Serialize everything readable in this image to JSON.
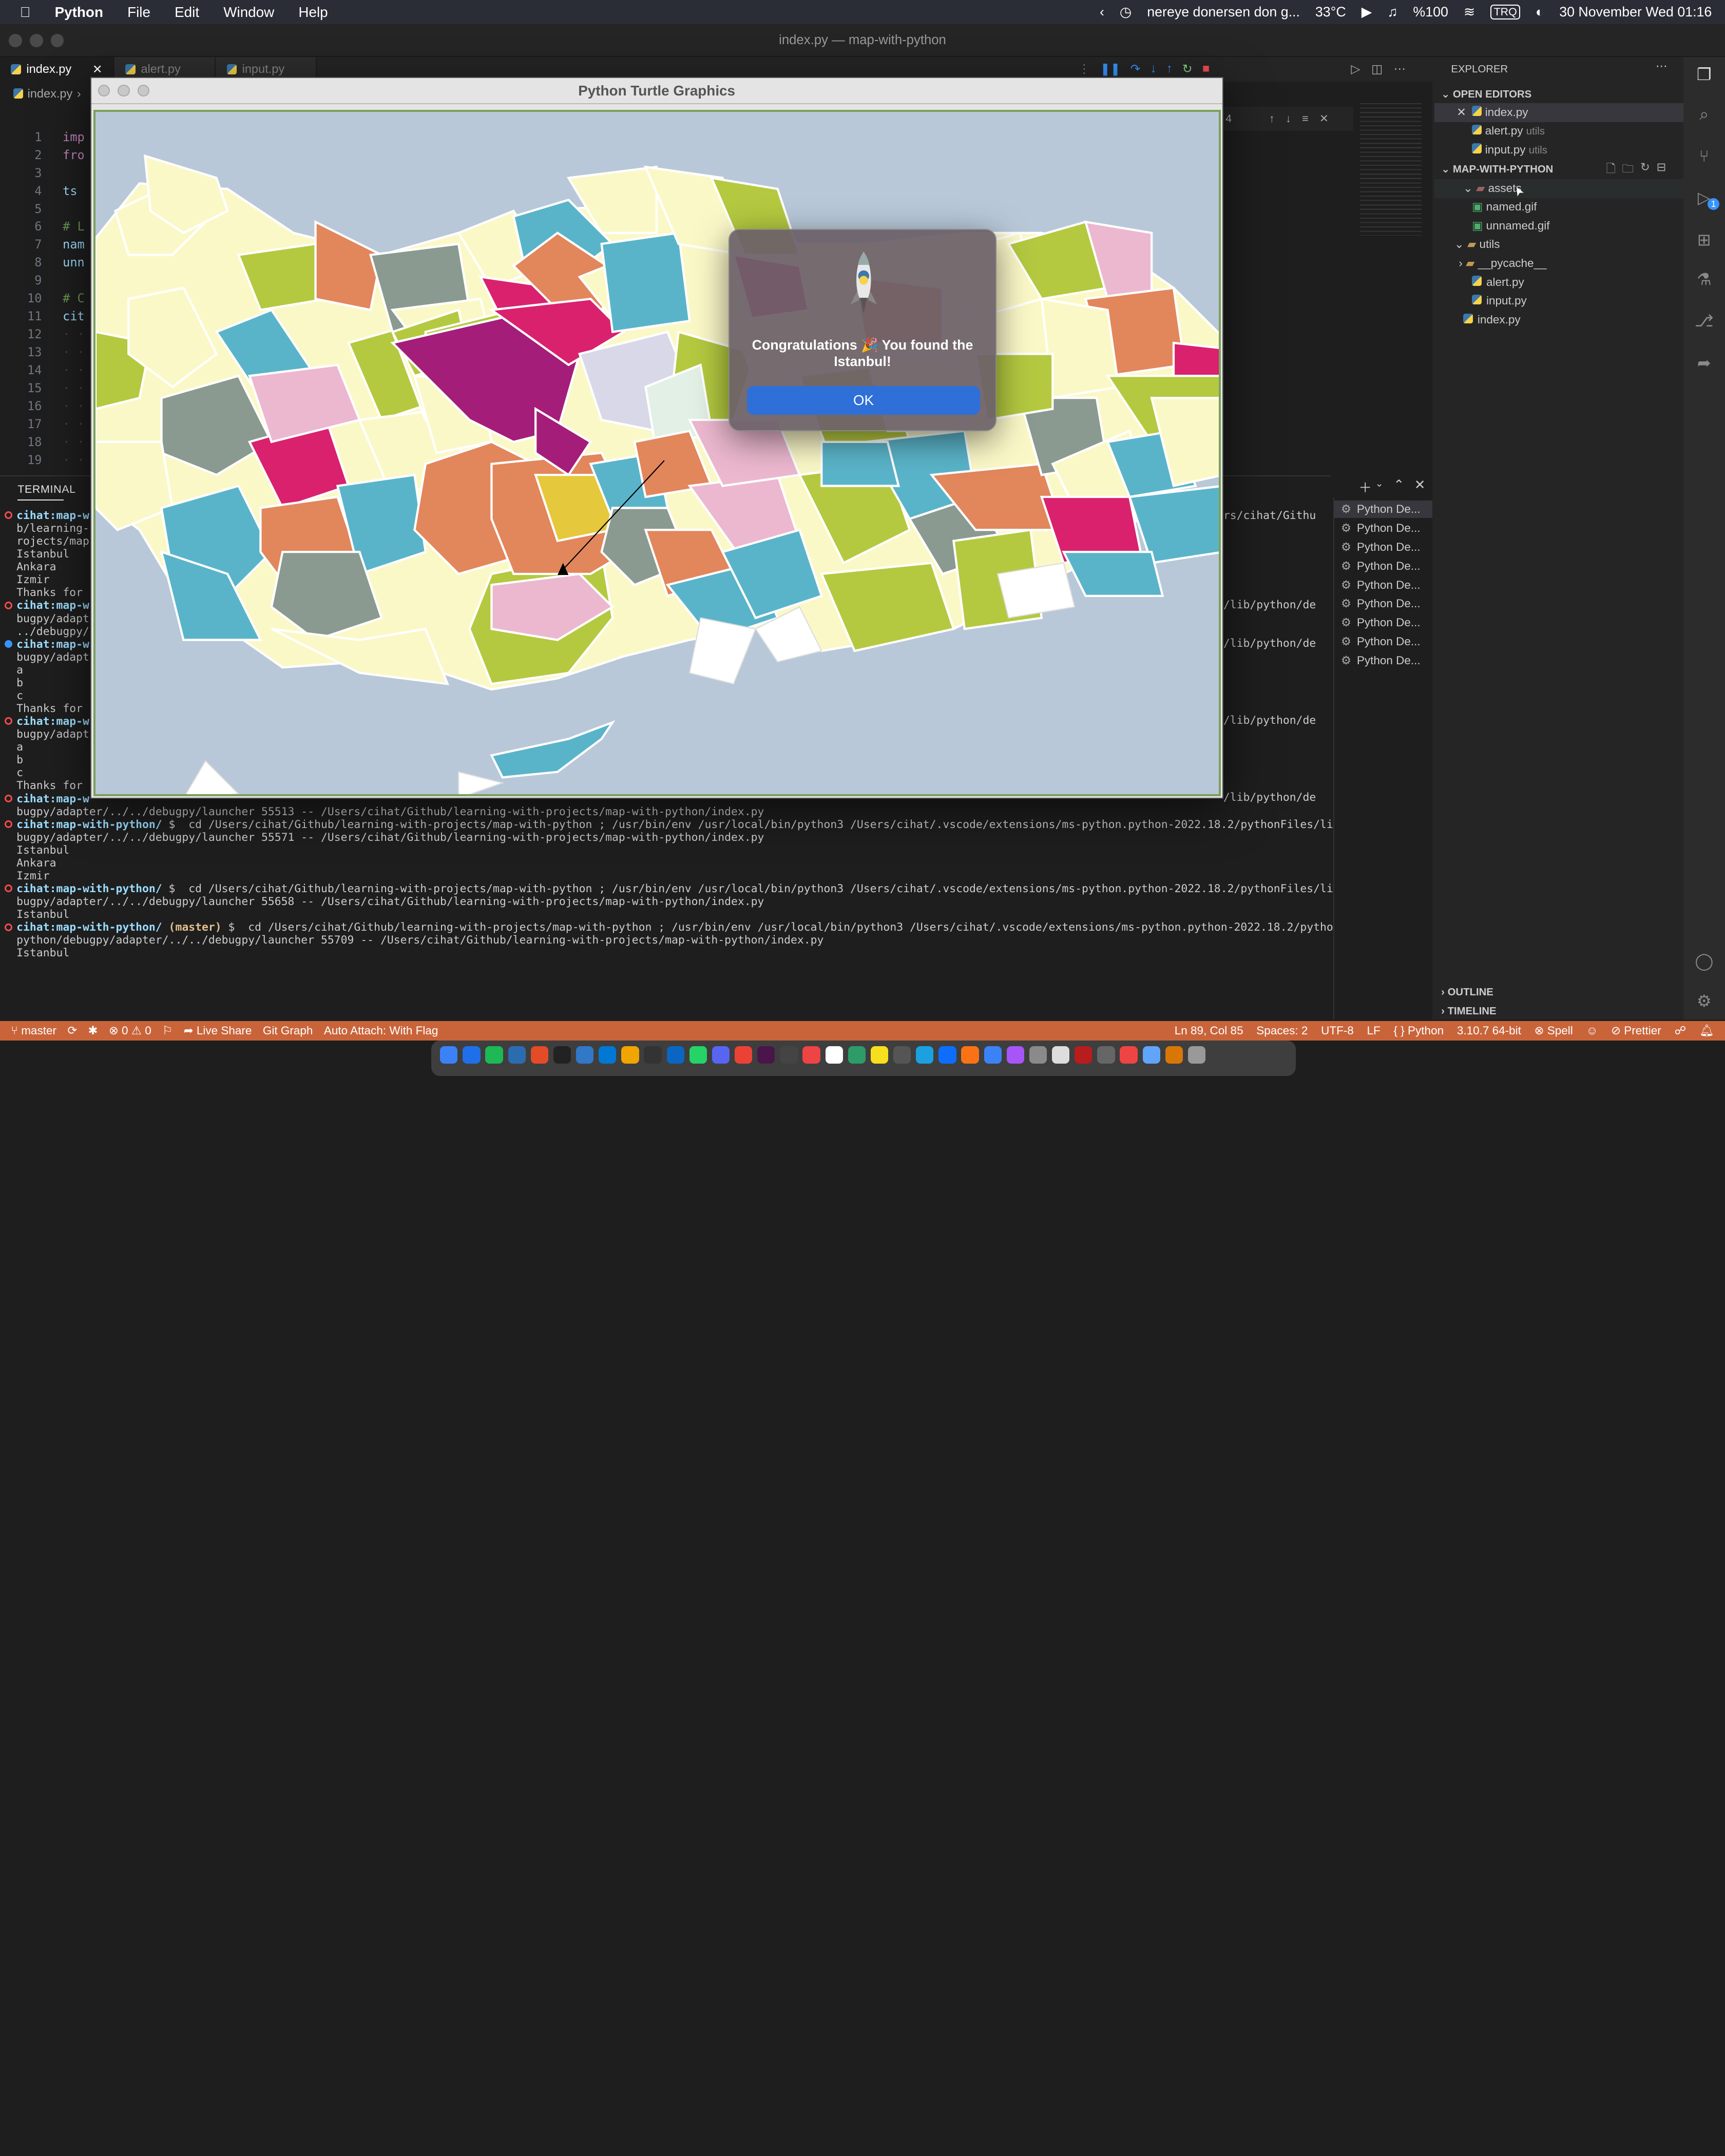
{
  "menubar": {
    "app": "Python",
    "items": [
      "File",
      "Edit",
      "Window",
      "Help"
    ],
    "music": "nereye donersen don g...",
    "temp": "33°C",
    "battery": "%100",
    "lang": "TRQ",
    "datetime": "30 November Wed  01:16"
  },
  "window": {
    "title": "index.py — map-with-python"
  },
  "tabs": [
    {
      "label": "index.py"
    },
    {
      "label": "alert.py"
    },
    {
      "label": "input.py"
    }
  ],
  "breadcrumb": "index.py",
  "editor": {
    "line_numbers": [
      "1",
      "2",
      "3",
      "4",
      "5",
      "6",
      "7",
      "8",
      "9",
      "10",
      "11",
      "12",
      "13",
      "14",
      "15",
      "16",
      "17",
      "18",
      "19"
    ],
    "lines": [
      "imp",
      "fro",
      "",
      "ts",
      "",
      "# L",
      "nam",
      "unn",
      "",
      "# C",
      "cit",
      "",
      "",
      "",
      "",
      "",
      "",
      "",
      ""
    ]
  },
  "terminal": {
    "header": "TERMINAL",
    "lines": [
      {
        "prompt": "cihat:map-w",
        "text": ""
      },
      {
        "text": "b/learning-"
      },
      {
        "text": "rojects/map"
      },
      {
        "text": "Istanbul"
      },
      {
        "text": "Ankara"
      },
      {
        "text": "Izmir"
      },
      {
        "text": "Thanks for"
      },
      {
        "prompt": "cihat:map-w",
        "text": ""
      },
      {
        "text": "bugpy/adapt"
      },
      {
        "text": "../debugpy/"
      },
      {
        "prompt": "cihat:map-w",
        "text": ""
      },
      {
        "text": "bugpy/adapt"
      },
      {
        "text": "a"
      },
      {
        "text": "b"
      },
      {
        "text": "c"
      },
      {
        "text": "Thanks for"
      },
      {
        "prompt": "cihat:map-w",
        "text": ""
      },
      {
        "text": "bugpy/adapt"
      },
      {
        "text": "a"
      },
      {
        "text": "b"
      },
      {
        "text": "c"
      },
      {
        "text": "Thanks for"
      },
      {
        "prompt": "cihat:map-w",
        "text": ""
      },
      {
        "text": "bugpy/adapter/../../debugpy/launcher 55513 -- /Users/cihat/Github/learning-with-projects/map-with-python/index.py"
      },
      {
        "prompt": "cihat:map-with-python/",
        "text": " $  cd /Users/cihat/Github/learning-with-projects/map-with-python ; /usr/bin/env /usr/local/bin/python3 /Users/cihat/.vscode/extensions/ms-python.python-2022.18.2/pythonFiles/lib/python/de"
      },
      {
        "text": "bugpy/adapter/../../debugpy/launcher 55571 -- /Users/cihat/Github/learning-with-projects/map-with-python/index.py"
      },
      {
        "text": "Istanbul"
      },
      {
        "text": "Ankara"
      },
      {
        "text": "Izmir"
      },
      {
        "prompt": "cihat:map-with-python/",
        "text": " $  cd /Users/cihat/Github/learning-with-projects/map-with-python ; /usr/bin/env /usr/local/bin/python3 /Users/cihat/.vscode/extensions/ms-python.python-2022.18.2/pythonFiles/lib/python/de"
      },
      {
        "text": "bugpy/adapter/../../debugpy/launcher 55658 -- /Users/cihat/Github/learning-with-projects/map-with-python/index.py"
      },
      {
        "text": "Istanbul"
      },
      {
        "prompt": "cihat:map-with-python/",
        "branch": " (master)",
        "text": " $  cd /Users/cihat/Github/learning-with-projects/map-with-python ; /usr/bin/env /usr/local/bin/python3 /Users/cihat/.vscode/extensions/ms-python.python-2022.18.2/pythonFiles/lib/"
      },
      {
        "text": "python/debugpy/adapter/../../debugpy/launcher 55709 -- /Users/cihat/Github/learning-with-projects/map-with-python/index.py"
      },
      {
        "text": "Istanbul"
      }
    ],
    "right_fragments": [
      "rs/cihat/Githu",
      "/lib/python/de",
      "/lib/python/de",
      "/lib/python/de",
      "/lib/python/de"
    ],
    "sessions": [
      "Python De...",
      "Python De...",
      "Python De...",
      "Python De...",
      "Python De...",
      "Python De...",
      "Python De...",
      "Python De...",
      "Python De..."
    ]
  },
  "explorer": {
    "title": "EXPLORER",
    "open_editors": "OPEN EDITORS",
    "open_files": [
      {
        "name": "index.py",
        "hint": ""
      },
      {
        "name": "alert.py",
        "hint": "utils"
      },
      {
        "name": "input.py",
        "hint": "utils"
      }
    ],
    "project": "MAP-WITH-PYTHON",
    "tree": [
      {
        "name": "assets",
        "type": "folder"
      },
      {
        "name": "named.gif",
        "type": "img"
      },
      {
        "name": "unnamed.gif",
        "type": "img"
      },
      {
        "name": "utils",
        "type": "folder"
      },
      {
        "name": "__pycache__",
        "type": "folder"
      },
      {
        "name": "alert.py",
        "type": "py"
      },
      {
        "name": "input.py",
        "type": "py"
      },
      {
        "name": "index.py",
        "type": "py"
      }
    ],
    "outline": "OUTLINE",
    "timeline": "TIMELINE"
  },
  "turtle": {
    "title": "Python Turtle Graphics"
  },
  "dialog": {
    "message": "Congratulations 🎉 You found the Istanbul!",
    "ok": "OK"
  },
  "statusbar": {
    "branch": "master",
    "problems": "⊗ 0 ⚠ 0",
    "live_share": "Live Share",
    "git_graph": "Git Graph",
    "auto_attach": "Auto Attach: With Flag",
    "position": "Ln 89, Col 85",
    "spaces": "Spaces: 2",
    "encoding": "UTF-8",
    "eol": "LF",
    "language": "Python",
    "interpreter": "3.10.7 64-bit",
    "spell": "Spell",
    "prettier": "Prettier"
  },
  "find_count": "4",
  "debug_badge": "1",
  "colors": {
    "statusbar": "#c9643a",
    "accent": "#3794ff",
    "map_water": "#b8c8d8"
  }
}
